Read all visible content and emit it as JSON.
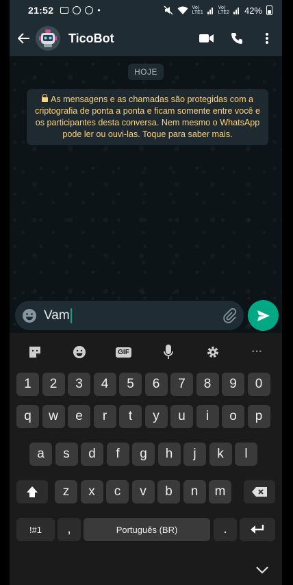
{
  "status_bar": {
    "time": "21:52",
    "dot": "•",
    "signal_label": "Vo)\nLTE1",
    "signal2_label": "Vo)\nLTE2",
    "battery": "42%"
  },
  "header": {
    "contact_name": "TicoBot"
  },
  "chat": {
    "date_chip": "HOJE",
    "encryption_notice": "As mensagens e as chamadas são protegidas com a criptografia de ponta a ponta e ficam somente entre você e os participantes desta conversa. Nem mesmo o WhatsApp pode ler ou ouvi-las. Toque para saber mais."
  },
  "composer": {
    "text": "Vam"
  },
  "keyboard": {
    "toolbar": {
      "gif": "GIF",
      "more": "···"
    },
    "numbers": [
      "1",
      "2",
      "3",
      "4",
      "5",
      "6",
      "7",
      "8",
      "9",
      "0"
    ],
    "row1": [
      "q",
      "w",
      "e",
      "r",
      "t",
      "y",
      "u",
      "i",
      "o",
      "p"
    ],
    "row2": [
      "a",
      "s",
      "d",
      "f",
      "g",
      "h",
      "j",
      "k",
      "l"
    ],
    "row3": [
      "z",
      "x",
      "c",
      "v",
      "b",
      "n",
      "m"
    ],
    "symbols": "!#1",
    "comma": ",",
    "space": "Português (BR)",
    "period": "."
  },
  "colors": {
    "accent": "#00a884",
    "header_bg": "#1f2c34",
    "notice_text": "#ffd279",
    "chat_bg": "#0d1418"
  }
}
